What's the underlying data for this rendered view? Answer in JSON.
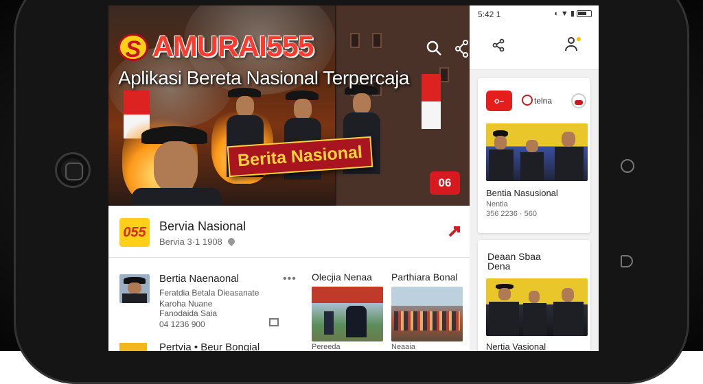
{
  "hero": {
    "brand_mark": "S",
    "brand_name": "AMURAI555",
    "tagline": "Aplikasi Bereta Nasional Terpercaja",
    "ribbon": "Berita Nasional",
    "badge": "06",
    "icons": [
      "search-icon",
      "share-icon"
    ]
  },
  "section": {
    "logo_text": "055",
    "title": "Bervia Nasional",
    "subtitle": "Bervia 3·1 1908",
    "icons": [
      "pin-icon",
      "share-icon"
    ]
  },
  "news": [
    {
      "title": "Bertia Naenaonal",
      "desc1": "Feratdia Betala Dieasanate",
      "desc2": "Karoha Nuane",
      "desc3": "Fanodaida Saia",
      "meta": "04 1236 900",
      "icons": [
        "more-icon",
        "bookmark-icon"
      ]
    },
    {
      "title": "Olecjia Nenaa"
    },
    {
      "title": "Parthiara Bonal"
    },
    {
      "title": "Pertvia • Beur Bongial"
    }
  ],
  "grid_captions": {
    "c1": "Pereeda",
    "c2": "Neaaia"
  },
  "right": {
    "status": {
      "time": "5:42 1",
      "icons": "◐ ▼ ▮"
    },
    "appbar_icons": [
      "share-icon",
      "user-icon"
    ],
    "logos": {
      "red": "o–",
      "middle": "telna"
    },
    "card1": {
      "title": "Bentia Nasusional",
      "sub1": "Nentia",
      "sub2": "356 2236 · 560"
    },
    "card2": {
      "heading1": "Deaan  Sbaa",
      "heading2": "Dena",
      "title": "Nertia Vasional"
    }
  },
  "colors": {
    "brand_red": "#d71920",
    "brand_yellow": "#ffcf1a",
    "ribbon_text": "#ffd23b"
  }
}
